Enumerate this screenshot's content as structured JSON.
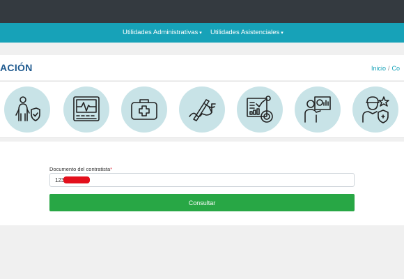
{
  "nav": {
    "items": [
      {
        "label": "Utilidades Administrativas",
        "caret": "▾"
      },
      {
        "label": "Utilidades Asistenciales",
        "caret": "▾"
      }
    ]
  },
  "header": {
    "title": "ACIÓN",
    "breadcrumb": {
      "home": "Inicio",
      "separator": "/",
      "current": "Co"
    }
  },
  "icons": [
    {
      "name": "person-shield-icon"
    },
    {
      "name": "monitor-heartbeat-icon"
    },
    {
      "name": "first-aid-kit-icon"
    },
    {
      "name": "hand-signature-icon"
    },
    {
      "name": "analytics-report-icon"
    },
    {
      "name": "teacher-presentation-icon"
    },
    {
      "name": "medical-worker-icon"
    }
  ],
  "form": {
    "label": "Documento del contratista",
    "required_mark": "*",
    "input_value": "123",
    "submit_label": "Consultar"
  },
  "colors": {
    "topbar": "#343a40",
    "navbar": "#17a2b8",
    "title": "#1f5a8f",
    "icon_bg": "#c8e3e7",
    "button": "#28a745",
    "redaction": "#e3101c"
  }
}
